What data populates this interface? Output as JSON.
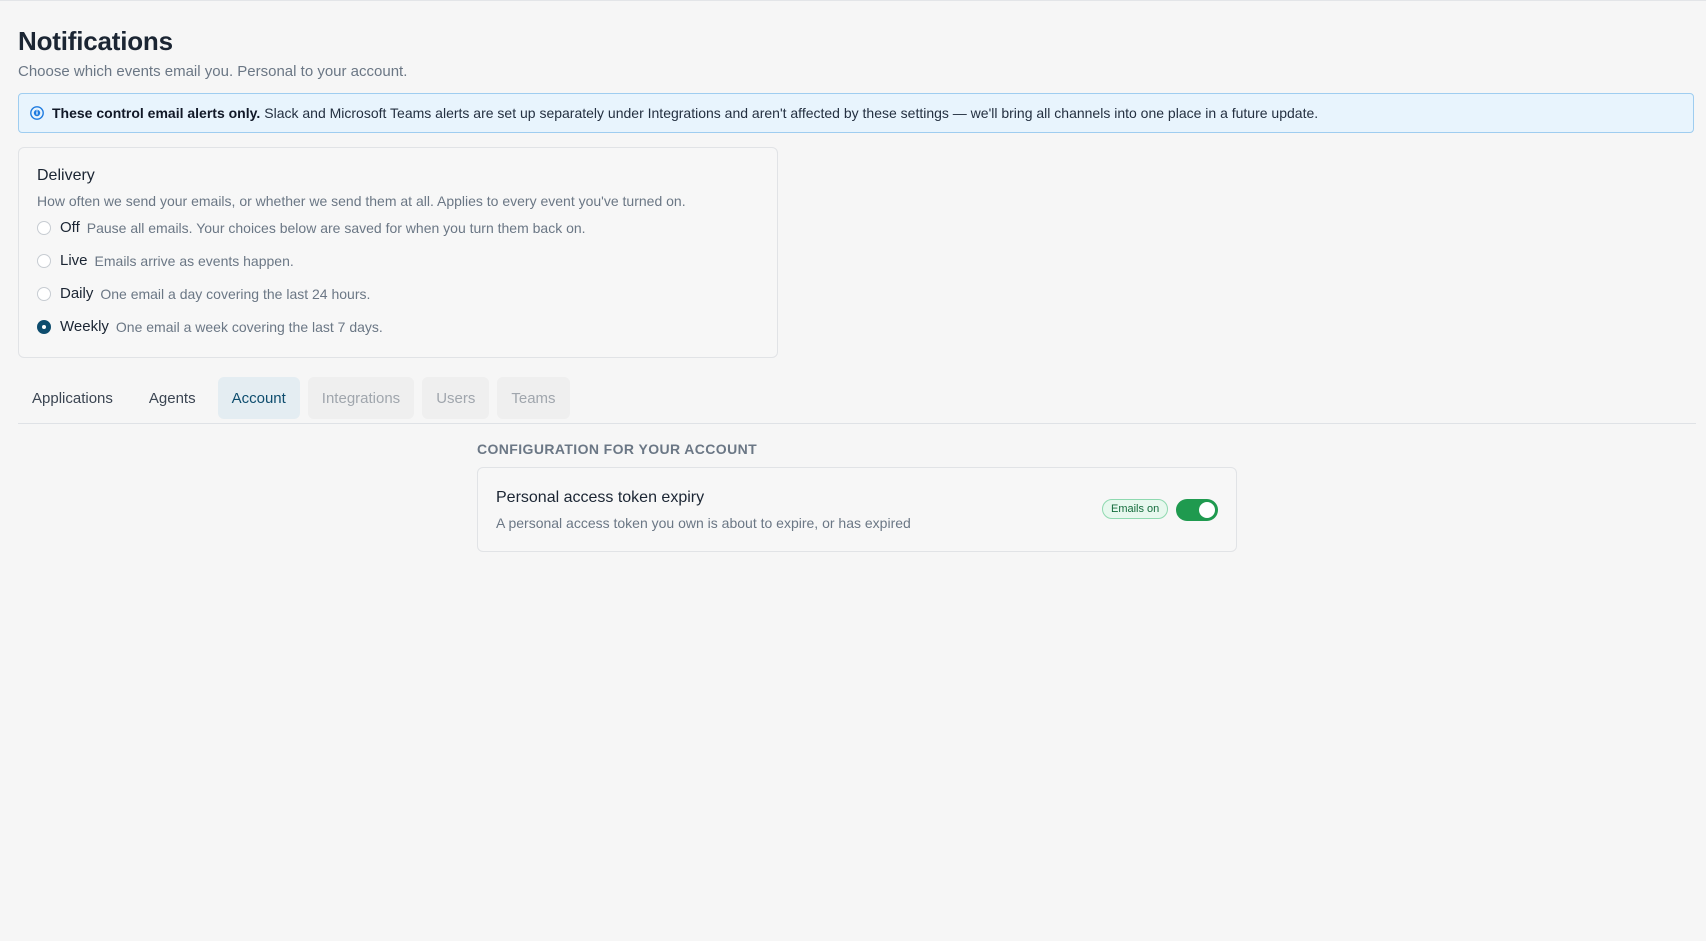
{
  "header": {
    "title": "Notifications",
    "subtitle": "Choose which events email you. Personal to your account."
  },
  "banner": {
    "icon": "info-icon",
    "strong": "These control email alerts only.",
    "text": "Slack and Microsoft Teams alerts are set up separately under Integrations and aren't affected by these settings — we'll bring all channels into one place in a future update."
  },
  "delivery": {
    "title": "Delivery",
    "description": "How often we send your emails, or whether we send them at all. Applies to every event you've turned on.",
    "selected": "Weekly",
    "options": [
      {
        "label": "Off",
        "help": "Pause all emails. Your choices below are saved for when you turn them back on."
      },
      {
        "label": "Live",
        "help": "Emails arrive as events happen."
      },
      {
        "label": "Daily",
        "help": "One email a day covering the last 24 hours."
      },
      {
        "label": "Weekly",
        "help": "One email a week covering the last 7 days."
      }
    ]
  },
  "tabs": {
    "active": "Account",
    "items": [
      {
        "label": "Applications",
        "state": "enabled"
      },
      {
        "label": "Agents",
        "state": "enabled"
      },
      {
        "label": "Account",
        "state": "active"
      },
      {
        "label": "Integrations",
        "state": "disabled"
      },
      {
        "label": "Users",
        "state": "disabled"
      },
      {
        "label": "Teams",
        "state": "disabled"
      }
    ]
  },
  "account_section": {
    "heading": "CONFIGURATION FOR YOUR ACCOUNT",
    "settings": [
      {
        "title": "Personal access token expiry",
        "description": "A personal access token you own is about to expire, or has expired",
        "badge": "Emails on",
        "enabled": true
      }
    ]
  },
  "colors": {
    "accent": "#0e4d6e",
    "banner_bg": "#e8f4fd",
    "toggle_on": "#1f9a4f",
    "badge_text": "#146c3c"
  }
}
